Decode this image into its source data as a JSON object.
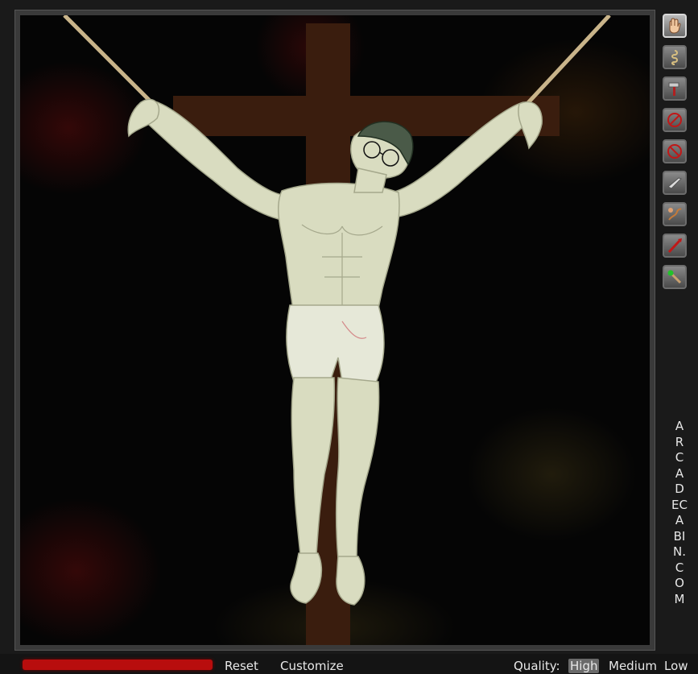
{
  "toolbar": {
    "tools": [
      {
        "icon": "hand-icon",
        "selected": true
      },
      {
        "icon": "rope-coil-icon",
        "selected": false
      },
      {
        "icon": "hammer-icon",
        "selected": false
      },
      {
        "icon": "no-nail-icon",
        "selected": false
      },
      {
        "icon": "no-spike-icon",
        "selected": false
      },
      {
        "icon": "knife-icon",
        "selected": false
      },
      {
        "icon": "whip-icon",
        "selected": false
      },
      {
        "icon": "red-spear-icon",
        "selected": false
      },
      {
        "icon": "magic-wand-icon",
        "selected": false
      }
    ]
  },
  "sidebar": {
    "site_text": "ARCADECABIN.COM"
  },
  "bottom_bar": {
    "reset_label": "Reset",
    "customize_label": "Customize",
    "quality_label": "Quality:",
    "quality_options": [
      "High",
      "Medium",
      "Low"
    ],
    "quality_selected": "High",
    "banner_color": "#b80d0d"
  },
  "scene": {
    "background_color": "#050505",
    "cross_color": "#3a1d0e",
    "rope_color": "#c9b48a",
    "figure_color": "#d9dcc0"
  }
}
